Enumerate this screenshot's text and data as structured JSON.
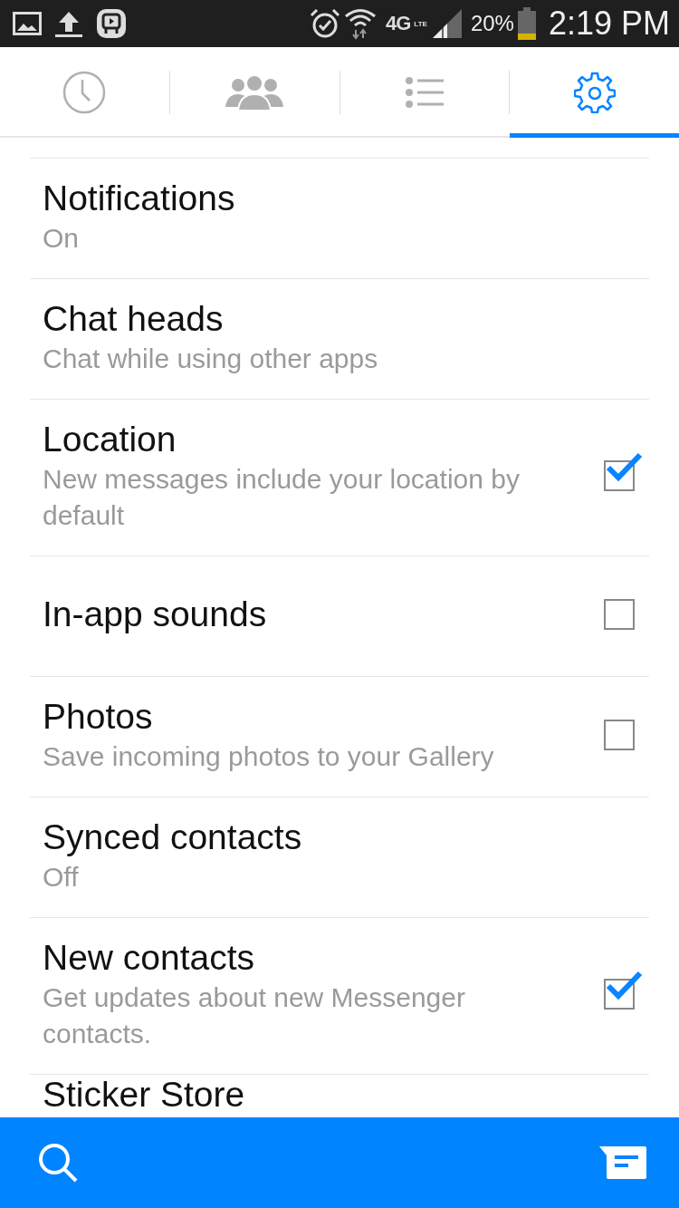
{
  "status_bar": {
    "network": "4G",
    "network_sub": "LTE",
    "battery": "20%",
    "time": "2:19 PM"
  },
  "tabs": [
    {
      "selected": false
    },
    {
      "selected": false
    },
    {
      "selected": false
    },
    {
      "selected": true
    }
  ],
  "settings": [
    {
      "kind": "text",
      "title": "Notifications",
      "subtitle": "On"
    },
    {
      "kind": "text",
      "title": "Chat heads",
      "subtitle": "Chat while using other apps"
    },
    {
      "kind": "checkbox",
      "title": "Location",
      "subtitle": "New messages include your location by default",
      "checked": true
    },
    {
      "kind": "checkbox",
      "title": "In-app sounds",
      "checked": false
    },
    {
      "kind": "checkbox",
      "title": "Photos",
      "subtitle": "Save incoming photos to your Gallery",
      "checked": false
    },
    {
      "kind": "text",
      "title": "Synced contacts",
      "subtitle": "Off"
    },
    {
      "kind": "checkbox",
      "title": "New contacts",
      "subtitle": "Get updates about new Messenger contacts.",
      "checked": true
    },
    {
      "kind": "text",
      "title": "Sticker Store"
    }
  ]
}
